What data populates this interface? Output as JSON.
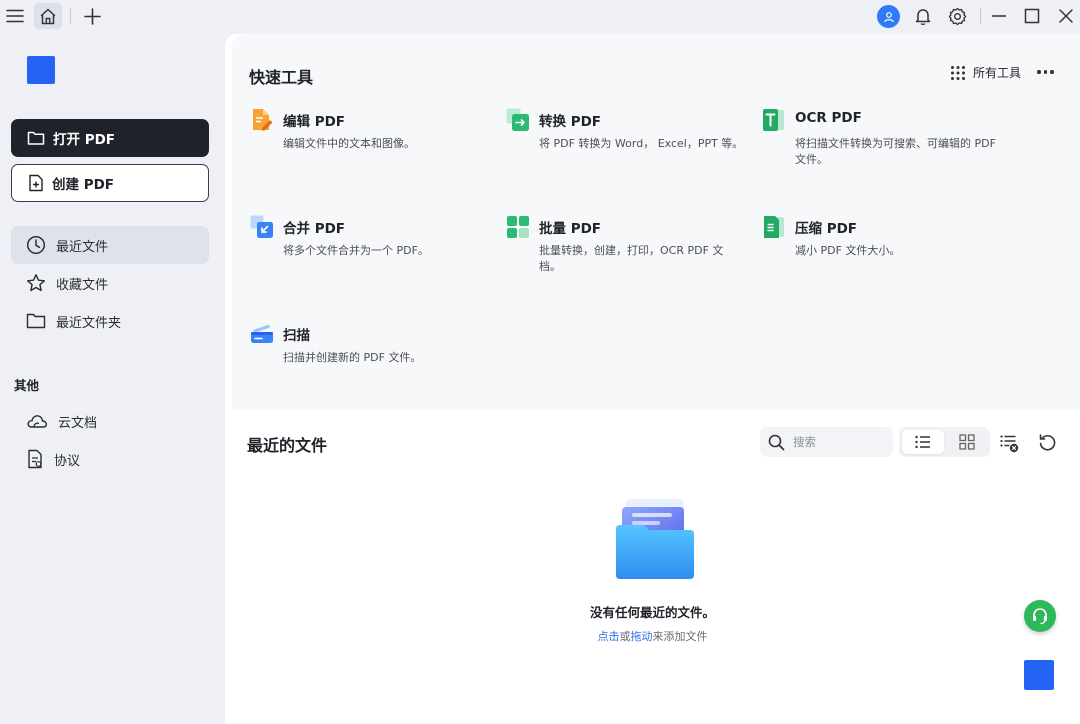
{
  "titlebar": {
    "menu_icon": "hamburger-icon",
    "home_icon": "home-icon",
    "add_tab_icon": "plus-icon",
    "avatar_icon": "user-icon",
    "notification_icon": "bell-icon",
    "settings_icon": "gear-icon",
    "window_controls": [
      "minimize-icon",
      "maximize-icon",
      "close-icon"
    ]
  },
  "sidebar": {
    "open_pdf": "打开 PDF",
    "create_pdf": "创建 PDF",
    "nav": [
      {
        "label": "最近文件",
        "icon": "clock-icon",
        "active": true
      },
      {
        "label": "收藏文件",
        "icon": "star-icon",
        "active": false
      },
      {
        "label": "最近文件夹",
        "icon": "folder-icon",
        "active": false
      }
    ],
    "other_title": "其他",
    "other": [
      {
        "label": "云文档",
        "icon": "cloud-icon"
      },
      {
        "label": "协议",
        "icon": "document-icon"
      }
    ]
  },
  "quick_tools": {
    "title": "快速工具",
    "all_tools": "所有工具",
    "more_icon": "more-dots-icon",
    "tools": [
      {
        "title": "编辑 PDF",
        "desc": "编辑文件中的文本和图像。",
        "icon": "edit-pdf-icon"
      },
      {
        "title": "转换 PDF",
        "desc": "将 PDF 转换为 Word， Excel，PPT 等。",
        "icon": "convert-pdf-icon"
      },
      {
        "title": "OCR PDF",
        "desc": "将扫描文件转换为可搜索、可编辑的 PDF 文件。",
        "icon": "ocr-pdf-icon"
      },
      {
        "title": "合并 PDF",
        "desc": "将多个文件合并为一个 PDF。",
        "icon": "merge-pdf-icon"
      },
      {
        "title": "批量 PDF",
        "desc": "批量转换，创建，打印，OCR PDF 文档。",
        "icon": "batch-pdf-icon"
      },
      {
        "title": "压缩 PDF",
        "desc": "减小 PDF 文件大小。",
        "icon": "compress-pdf-icon"
      },
      {
        "title": "扫描",
        "desc": "扫描并创建新的 PDF 文件。",
        "icon": "scan-icon"
      }
    ]
  },
  "recent": {
    "title": "最近的文件",
    "search_placeholder": "搜索",
    "empty_title": "没有任何最近的文件。",
    "empty_click": "点击",
    "empty_or": "或",
    "empty_drag": "拖动",
    "empty_rest": "来添加文件"
  },
  "colors": {
    "accent_blue": "#2563f5",
    "dark_button": "#20222b",
    "green_float": "#2fb85a",
    "link": "#2f6fe8"
  }
}
